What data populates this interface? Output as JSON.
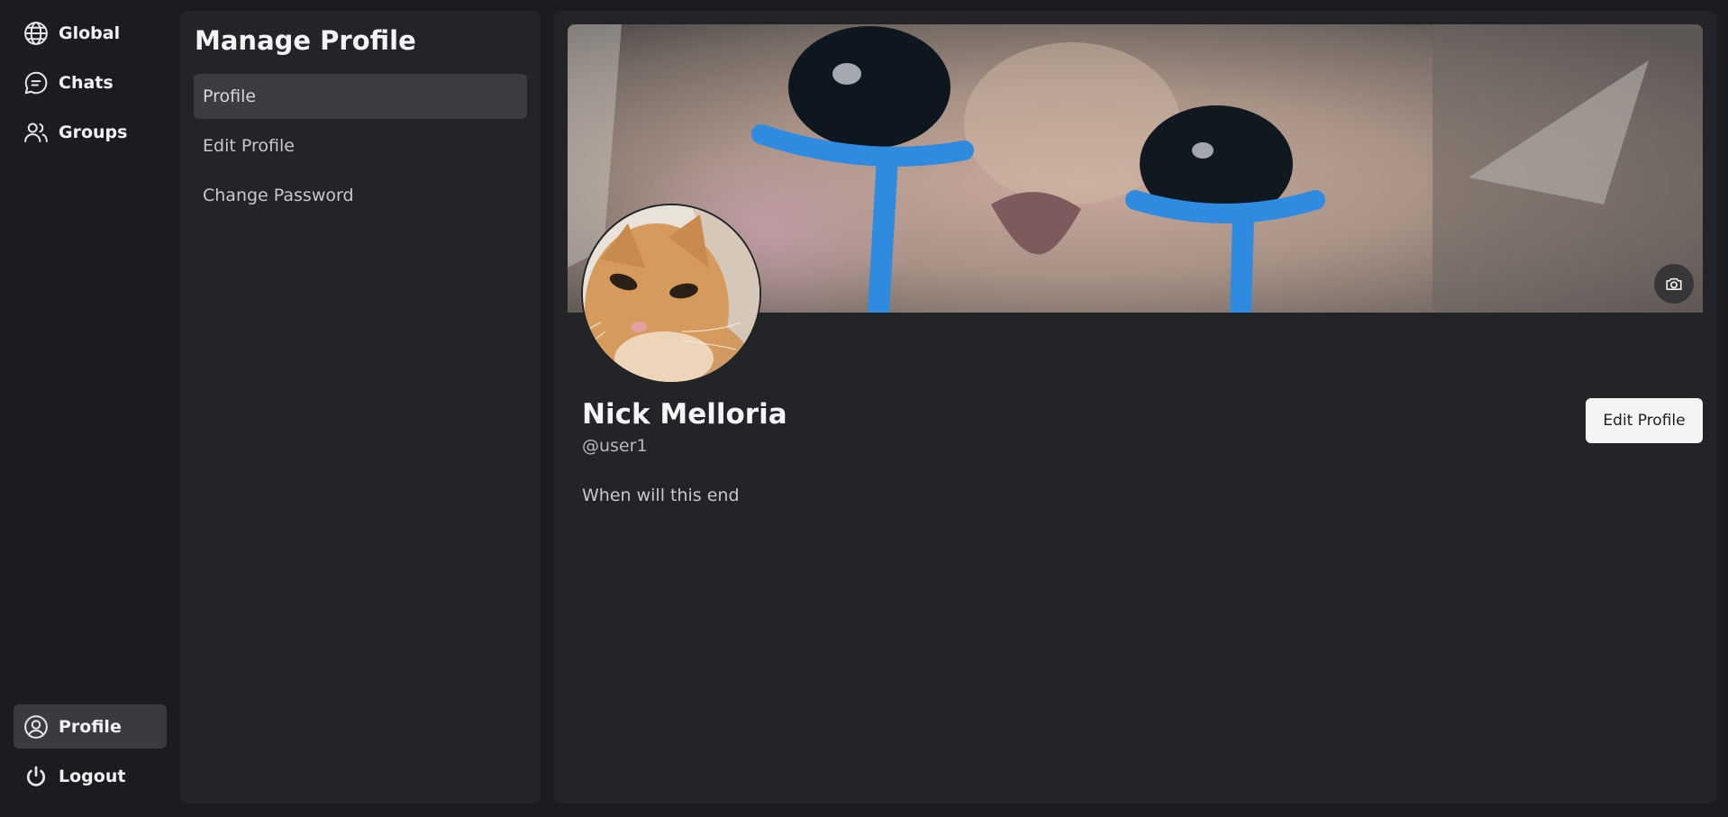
{
  "nav": {
    "items": [
      {
        "label": "Global",
        "icon": "globe-icon"
      },
      {
        "label": "Chats",
        "icon": "chat-bubble-icon"
      },
      {
        "label": "Groups",
        "icon": "users-icon"
      }
    ],
    "bottom": [
      {
        "label": "Profile",
        "icon": "user-circle-icon",
        "active": true
      },
      {
        "label": "Logout",
        "icon": "power-icon"
      }
    ]
  },
  "panel": {
    "title": "Manage Profile",
    "items": [
      {
        "label": "Profile",
        "active": true
      },
      {
        "label": "Edit Profile"
      },
      {
        "label": "Change Password"
      }
    ]
  },
  "profile": {
    "name": "Nick Melloria",
    "handle": "@user1",
    "bio": "When will this end",
    "edit_label": "Edit Profile",
    "banner_icon": "camera-icon"
  },
  "colors": {
    "background": "#1b1c20",
    "panel": "#232427",
    "active_item": "#3b3c40",
    "tear_blue": "#2f8be0"
  }
}
